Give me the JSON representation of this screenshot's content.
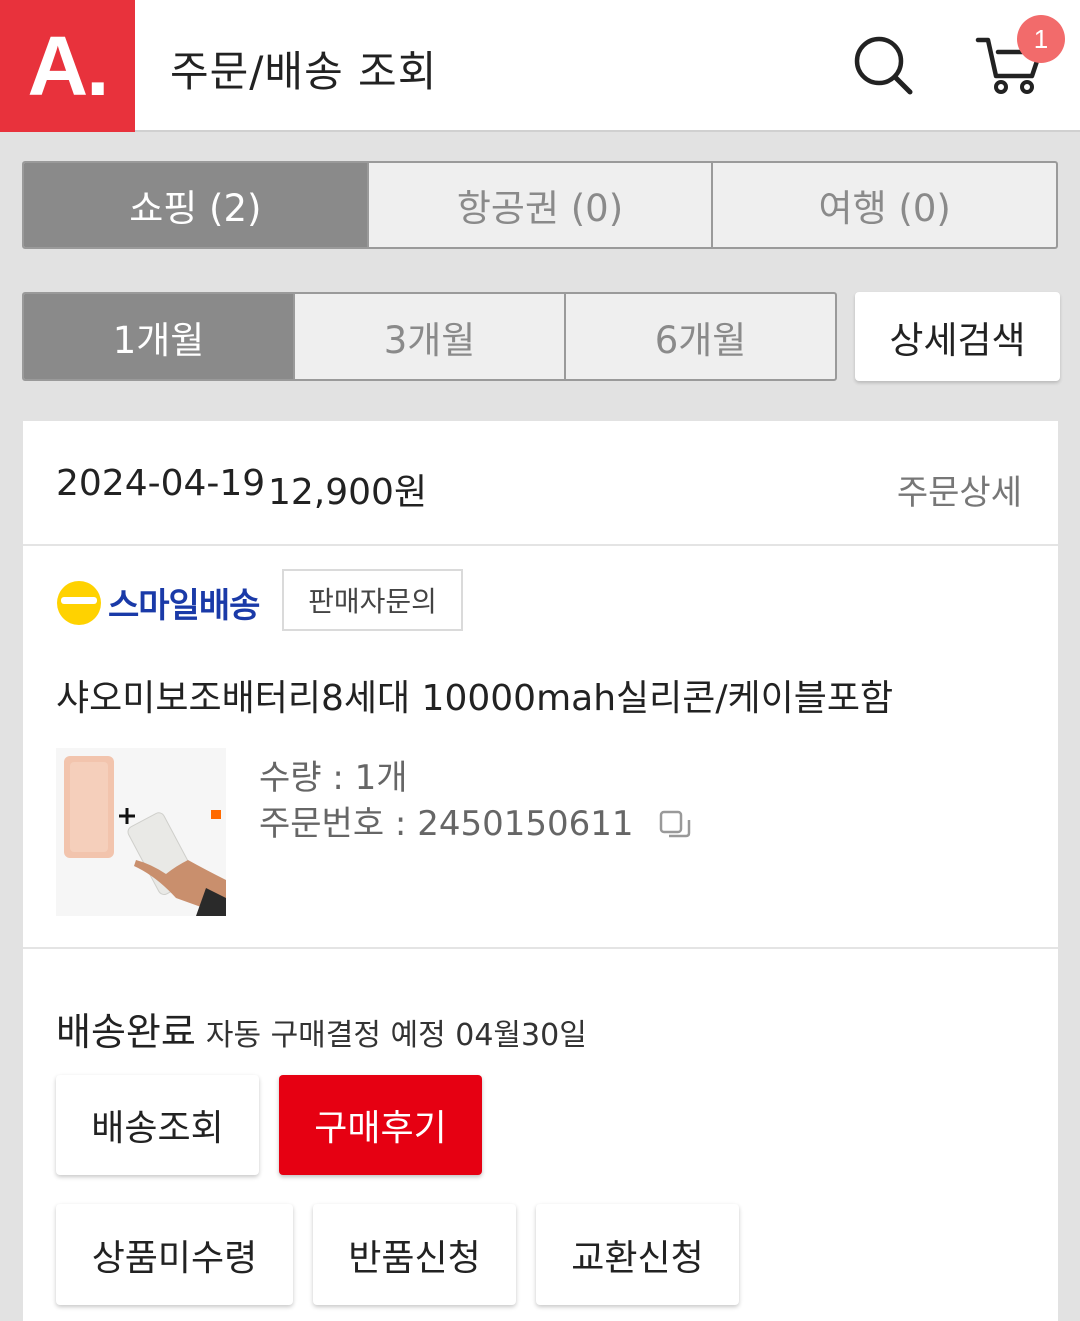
{
  "header": {
    "logo_text": "A.",
    "title": "주문/배송 조회",
    "cart_count": "1",
    "brand_color": "#e8323c"
  },
  "category_tabs": [
    {
      "label": "쇼핑 (2)",
      "active": true
    },
    {
      "label": "항공권 (0)",
      "active": false
    },
    {
      "label": "여행 (0)",
      "active": false
    }
  ],
  "period_tabs": [
    {
      "label": "1개월",
      "active": true
    },
    {
      "label": "3개월",
      "active": false
    },
    {
      "label": "6개월",
      "active": false
    }
  ],
  "detail_search_label": "상세검색",
  "order": {
    "date": "2024-04-19",
    "amount": "12,900원",
    "detail_link": "주문상세",
    "delivery_type": "스마일배송",
    "seller_inquiry": "판매자문의",
    "product_name": "샤오미보조배터리8세대 10000mah실리콘/케이블포함",
    "quantity": "수량 : 1개",
    "order_number_label": "주문번호 : ",
    "order_number": "2450150611",
    "status": "배송완료",
    "status_note": "자동 구매결정 예정 04월30일",
    "buttons": {
      "tracking": "배송조회",
      "review": "구매후기",
      "not_received": "상품미수령",
      "return": "반품신청",
      "exchange": "교환신청"
    }
  },
  "colors": {
    "accent_red": "#e60012",
    "tab_active": "#8a8a8a",
    "badge": "#f26b6b"
  }
}
